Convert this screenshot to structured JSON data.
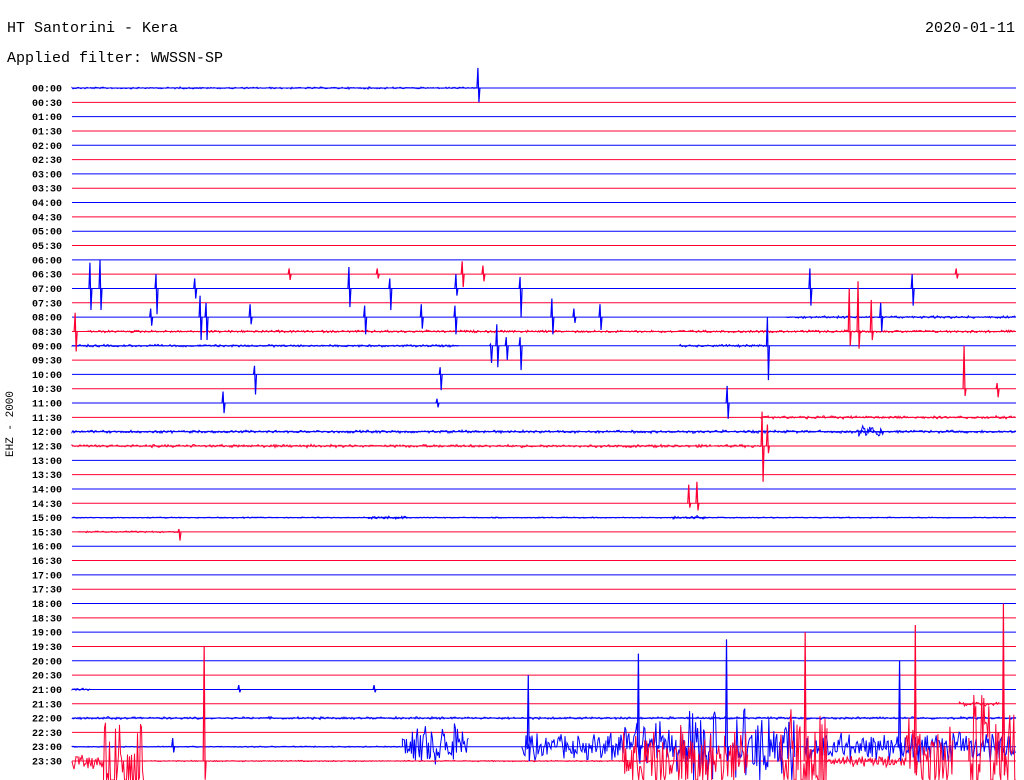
{
  "header": {
    "station": "HT Santorini - Kera",
    "filter": "Applied filter: WWSSN-SP",
    "date": "2020-01-11"
  },
  "chart_data": {
    "type": "line",
    "title": "HT Santorini - Kera",
    "ylabel": "EHZ - 2000",
    "minutes_per_row": 30,
    "amplitude_units": "row spacings (relative)",
    "colors": [
      "#0000ff",
      "#ff0033"
    ],
    "row_labels": [
      "00:00",
      "00:30",
      "01:00",
      "01:30",
      "02:00",
      "02:30",
      "03:00",
      "03:30",
      "04:00",
      "04:30",
      "05:00",
      "05:30",
      "06:00",
      "06:30",
      "07:00",
      "07:30",
      "08:00",
      "08:30",
      "09:00",
      "09:30",
      "10:00",
      "10:30",
      "11:00",
      "11:30",
      "12:00",
      "12:30",
      "13:00",
      "13:30",
      "14:00",
      "14:30",
      "15:00",
      "15:30",
      "16:00",
      "16:30",
      "17:00",
      "17:30",
      "18:00",
      "18:30",
      "19:00",
      "19:30",
      "20:00",
      "20:30",
      "21:00",
      "21:30",
      "22:00",
      "22:30",
      "23:00",
      "23:30"
    ],
    "spikes": [
      [
        0,
        12.9,
        1.4,
        1.0
      ],
      [
        13,
        6.9,
        0.4,
        0.4
      ],
      [
        13,
        9.7,
        0.4,
        0.3
      ],
      [
        13,
        12.4,
        0.9,
        0.9
      ],
      [
        13,
        13.06,
        0.6,
        0.5
      ],
      [
        13,
        28.1,
        0.4,
        0.3
      ],
      [
        14,
        0.57,
        1.8,
        1.5
      ],
      [
        14,
        0.89,
        2.0,
        1.5
      ],
      [
        14,
        2.67,
        1.0,
        1.8
      ],
      [
        14,
        3.9,
        0.7,
        0.7
      ],
      [
        14,
        8.8,
        1.5,
        1.3
      ],
      [
        14,
        10.1,
        0.7,
        1.5
      ],
      [
        14,
        12.2,
        1.0,
        0.5
      ],
      [
        14,
        14.24,
        0.8,
        2.0
      ],
      [
        14,
        23.45,
        1.4,
        1.2
      ],
      [
        14,
        26.7,
        1.0,
        1.2
      ],
      [
        16,
        2.5,
        0.6,
        0.6
      ],
      [
        16,
        4.07,
        1.5,
        1.6
      ],
      [
        16,
        4.26,
        1.0,
        1.6
      ],
      [
        16,
        5.66,
        0.9,
        0.5
      ],
      [
        16,
        9.3,
        0.8,
        1.2
      ],
      [
        16,
        11.1,
        0.9,
        0.8
      ],
      [
        16,
        12.17,
        0.8,
        1.2
      ],
      [
        16,
        15.25,
        1.3,
        1.2
      ],
      [
        16,
        15.95,
        0.6,
        0.4
      ],
      [
        16,
        16.78,
        0.9,
        0.9
      ],
      [
        16,
        25.7,
        1.0,
        1.0
      ],
      [
        17,
        0.1,
        1.3,
        1.4
      ],
      [
        17,
        24.7,
        3.0,
        1.0
      ],
      [
        17,
        24.98,
        3.5,
        1.2
      ],
      [
        17,
        25.4,
        2.2,
        0.6
      ],
      [
        18,
        13.3,
        0.1,
        1.2
      ],
      [
        18,
        13.5,
        1.5,
        1.5
      ],
      [
        18,
        13.8,
        0.6,
        1.0
      ],
      [
        18,
        14.24,
        0.6,
        1.7
      ],
      [
        18,
        22.1,
        2.0,
        2.4
      ],
      [
        20,
        11.7,
        0.5,
        1.1
      ],
      [
        20,
        5.8,
        0.6,
        1.4
      ],
      [
        21,
        28.35,
        3.0,
        0.5
      ],
      [
        21,
        29.4,
        0.4,
        0.6
      ],
      [
        22,
        4.8,
        0.8,
        0.7
      ],
      [
        22,
        11.6,
        0.3,
        0.3
      ],
      [
        22,
        20.82,
        1.2,
        1.1
      ],
      [
        25,
        21.93,
        2.4,
        2.5
      ],
      [
        25,
        22.1,
        1.5,
        0.5
      ],
      [
        29,
        19.86,
        1.5,
        0.5
      ],
      [
        29,
        19.6,
        1.3,
        0.3
      ],
      [
        31,
        3.4,
        0.2,
        0.6
      ],
      [
        47,
        4.2,
        8.0,
        1.3
      ],
      [
        46,
        3.2,
        0.6,
        0.4
      ],
      [
        42,
        5.3,
        0.3,
        0.2
      ],
      [
        42,
        9.6,
        0.3,
        0.2
      ],
      [
        46,
        14.5,
        5.0,
        1.0
      ],
      [
        46,
        18.0,
        6.5,
        1.0
      ],
      [
        46,
        20.8,
        7.5,
        1.0
      ],
      [
        46,
        26.3,
        6.0,
        1.0
      ],
      [
        47,
        29.6,
        11.0,
        1.0
      ],
      [
        47,
        26.8,
        9.5,
        1.0
      ],
      [
        47,
        23.3,
        9.0,
        1.0
      ]
    ],
    "bursts": [
      [
        0,
        0,
        12.9,
        0.08
      ],
      [
        17,
        0.5,
        30,
        0.1
      ],
      [
        18,
        0,
        12.3,
        0.1
      ],
      [
        18,
        19.3,
        22.1,
        0.1
      ],
      [
        16,
        22.7,
        30,
        0.1
      ],
      [
        23,
        21.9,
        30,
        0.12
      ],
      [
        24,
        0,
        30,
        0.12
      ],
      [
        24,
        25,
        25.8,
        0.6
      ],
      [
        25,
        0,
        21.9,
        0.12
      ],
      [
        30,
        0,
        30,
        0.05
      ],
      [
        30,
        9.4,
        10.7,
        0.15
      ],
      [
        30,
        19.1,
        20.2,
        0.2
      ],
      [
        31,
        0.2,
        3.4,
        0.07
      ],
      [
        42,
        0,
        0.6,
        0.1
      ],
      [
        43,
        28.2,
        29.5,
        0.2
      ],
      [
        44,
        0,
        30,
        0.1
      ],
      [
        46,
        0,
        10.5,
        0.05
      ],
      [
        46,
        10.5,
        12.6,
        1.8
      ],
      [
        46,
        14.3,
        17,
        1.0
      ],
      [
        46,
        17,
        19.5,
        2.0
      ],
      [
        46,
        19.5,
        20.5,
        3.5
      ],
      [
        46,
        21.0,
        23.0,
        3.0
      ],
      [
        46,
        23.3,
        30,
        1.2
      ],
      [
        47,
        0,
        1.0,
        0.6
      ],
      [
        47,
        1.0,
        2.3,
        5.0
      ],
      [
        47,
        2.3,
        19.5,
        0.05
      ],
      [
        47,
        17.5,
        21.5,
        3.0
      ],
      [
        47,
        22.5,
        24.0,
        5.5
      ],
      [
        47,
        24,
        26.5,
        0.5
      ],
      [
        47,
        26.5,
        28,
        3.5
      ],
      [
        47,
        28.5,
        30,
        5.5
      ]
    ]
  }
}
